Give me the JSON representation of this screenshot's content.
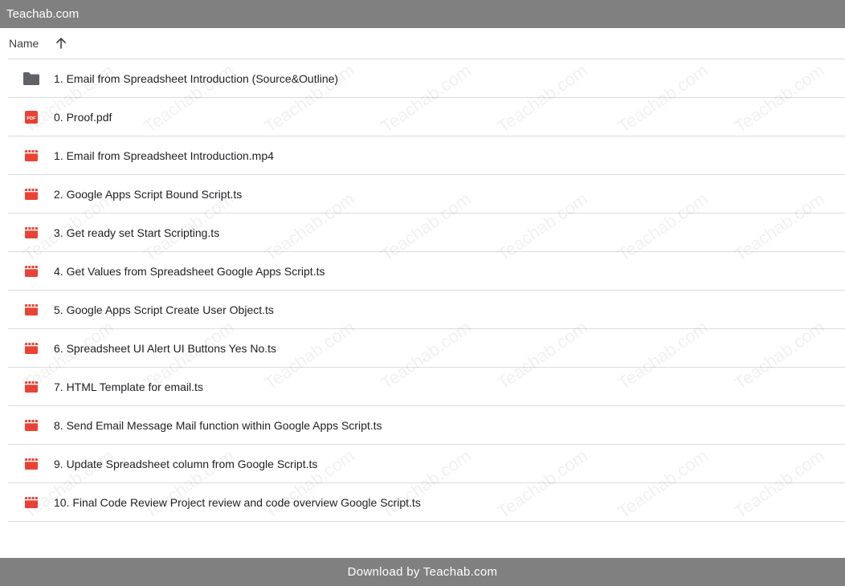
{
  "site": {
    "title": "Teachab.com"
  },
  "list": {
    "column_name": "Name",
    "sort_icon": "arrow-up-icon",
    "items": [
      {
        "name": "1. Email from Spreadsheet Introduction (Source&Outline)",
        "icon": "folder-icon"
      },
      {
        "name": "0. Proof.pdf",
        "icon": "pdf-icon"
      },
      {
        "name": "1. Email from Spreadsheet Introduction.mp4",
        "icon": "video-icon"
      },
      {
        "name": "2. Google Apps Script Bound Script.ts",
        "icon": "video-icon"
      },
      {
        "name": "3. Get ready set Start Scripting.ts",
        "icon": "video-icon"
      },
      {
        "name": "4. Get Values from Spreadsheet Google Apps Script.ts",
        "icon": "video-icon"
      },
      {
        "name": "5. Google Apps Script Create User Object.ts",
        "icon": "video-icon"
      },
      {
        "name": "6. Spreadsheet UI Alert UI Buttons Yes No.ts",
        "icon": "video-icon"
      },
      {
        "name": "7. HTML Template for email.ts",
        "icon": "video-icon"
      },
      {
        "name": "8. Send Email Message Mail function within Google Apps Script.ts",
        "icon": "video-icon"
      },
      {
        "name": "9. Update Spreadsheet column from Google Script.ts",
        "icon": "video-icon"
      },
      {
        "name": "10. Final Code Review Project review and code overview Google Script.ts",
        "icon": "video-icon"
      }
    ]
  },
  "footer": {
    "text": "Download by Teachab.com"
  },
  "watermark": {
    "text": "Teachab.com"
  },
  "colors": {
    "bar": "#808080",
    "folder": "#5f6368",
    "file_red": "#ea4335",
    "divider": "#dadce0"
  }
}
